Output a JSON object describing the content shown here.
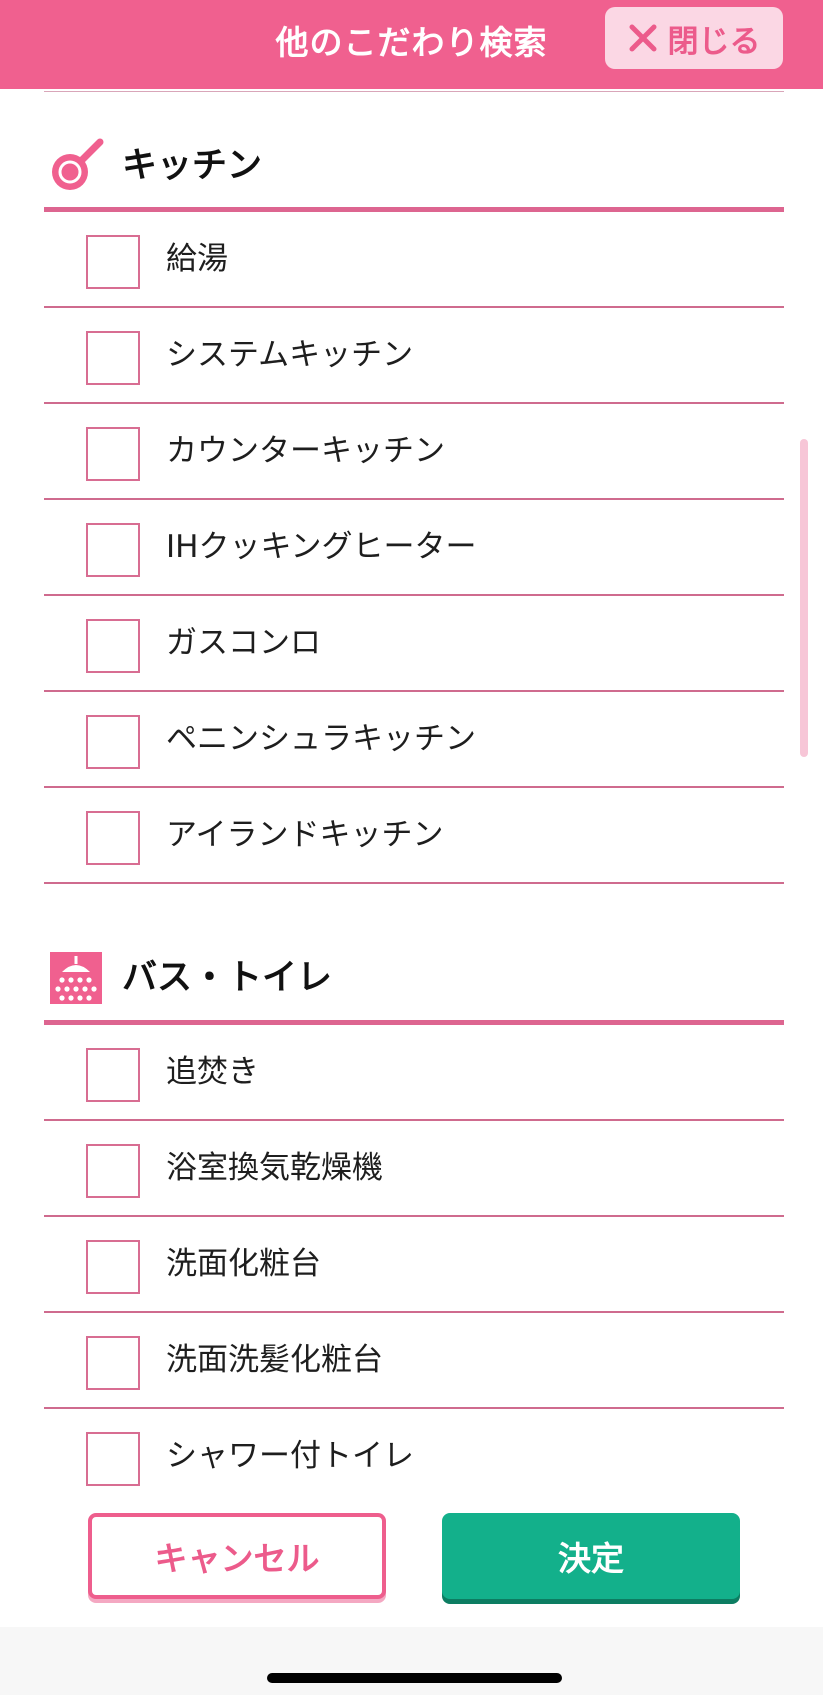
{
  "header": {
    "title": "他のこだわり検索",
    "close_label": "閉じる",
    "close_icon": "close-icon",
    "color": "#f0608f"
  },
  "sections": [
    {
      "title": "キッチン",
      "icon": "frying-pan-icon",
      "items": [
        {
          "label": "給湯",
          "checked": false
        },
        {
          "label": "システムキッチン",
          "checked": false
        },
        {
          "label": "カウンターキッチン",
          "checked": false
        },
        {
          "label": "IHクッキングヒーター",
          "checked": false
        },
        {
          "label": "ガスコンロ",
          "checked": false
        },
        {
          "label": "ペニンシュラキッチン",
          "checked": false
        },
        {
          "label": "アイランドキッチン",
          "checked": false
        }
      ]
    },
    {
      "title": "バス・トイレ",
      "icon": "shower-icon",
      "items": [
        {
          "label": "追焚き",
          "checked": false
        },
        {
          "label": "浴室換気乾燥機",
          "checked": false
        },
        {
          "label": "洗面化粧台",
          "checked": false
        },
        {
          "label": "洗面洗髪化粧台",
          "checked": false
        },
        {
          "label": "シャワー付トイレ",
          "checked": false
        }
      ]
    }
  ],
  "footer": {
    "cancel_label": "キャンセル",
    "confirm_label": "決定",
    "cancel_color": "#ee5e8d",
    "confirm_color": "#13b08b"
  }
}
